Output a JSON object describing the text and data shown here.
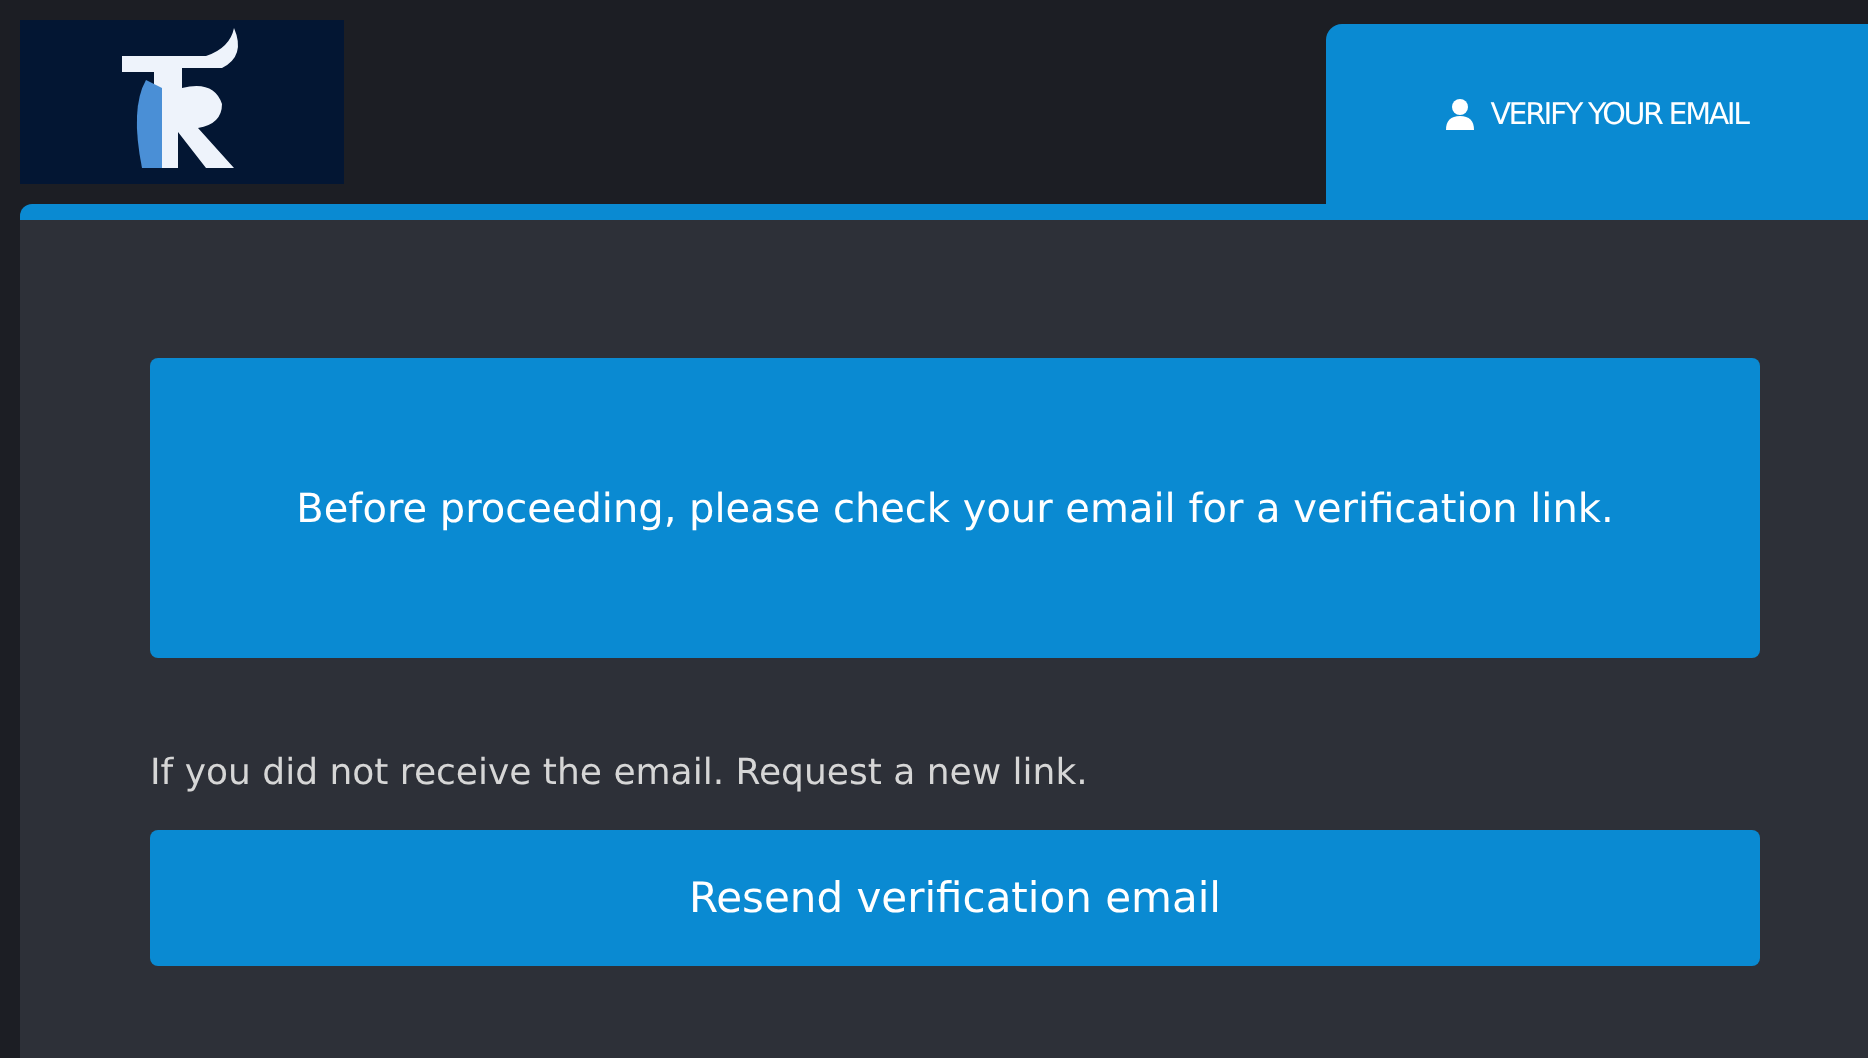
{
  "tabs": [
    {
      "label": "VERIFY YOUR EMAIL",
      "selected": true
    }
  ],
  "alert": {
    "message": "Before proceeding, please check your email for a verification link."
  },
  "hint": "If you did not receive the email. Request a new link.",
  "button": {
    "label": "Resend verification email"
  }
}
